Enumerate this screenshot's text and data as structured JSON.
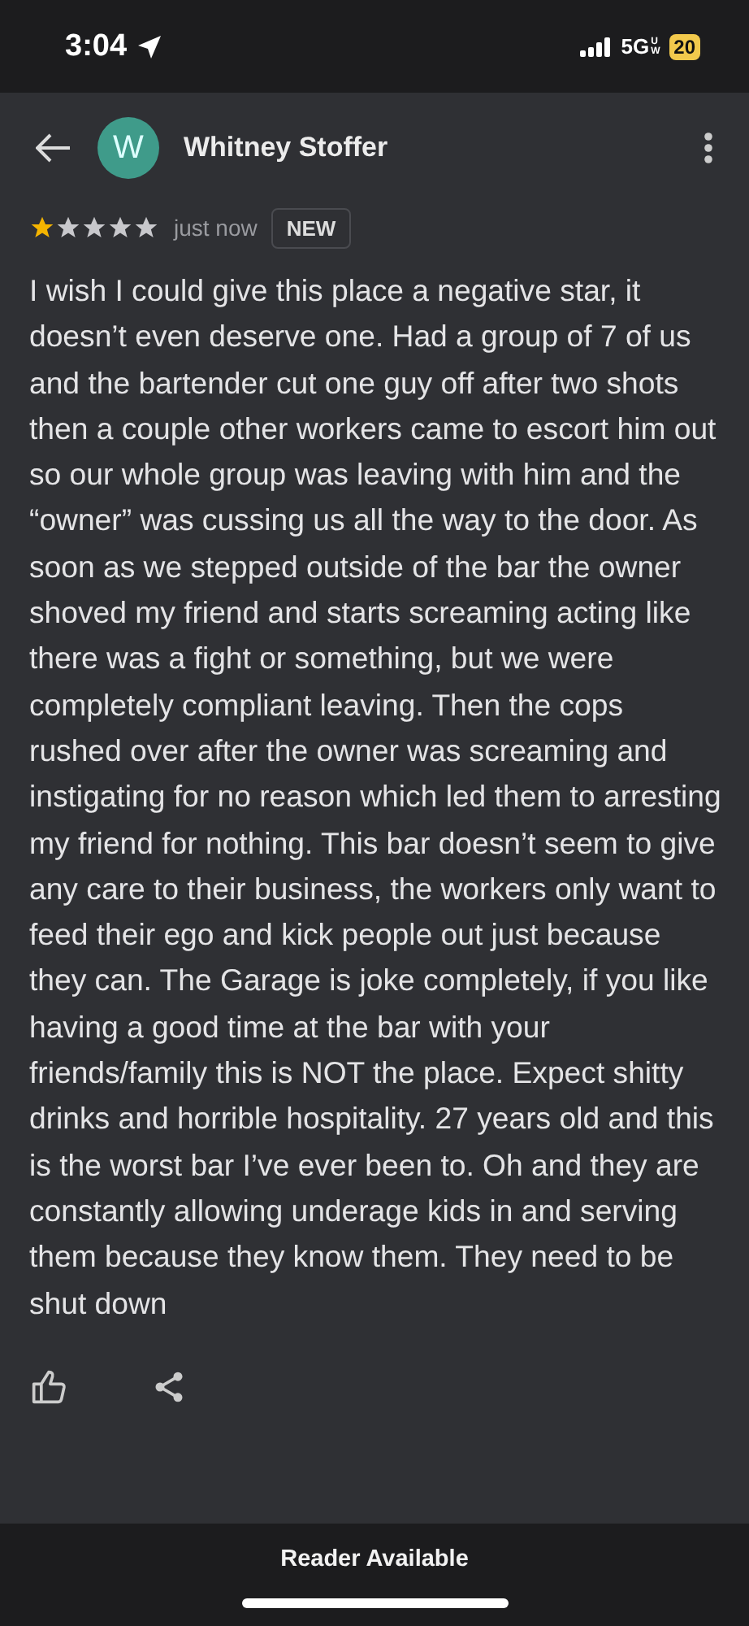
{
  "status_bar": {
    "time": "3:04",
    "network": "5G",
    "network_sub": "UW",
    "battery": "20"
  },
  "header": {
    "avatar_letter": "W",
    "name": "Whitney Stoffer"
  },
  "review": {
    "stars": 1,
    "time": "just now",
    "badge": "NEW",
    "text": "I wish I could give this place a negative star, it doesn’t even deserve one. Had a group of 7 of us and the bartender cut one guy off after two shots then a couple other workers came to escort him out so our whole group was leaving with him and the “owner” was cussing us all the way to the door. As soon as we stepped outside of the bar the owner shoved my friend and starts screaming acting like there was a fight or something, but we were completely compliant leaving. Then the cops rushed over after the owner was screaming and instigating for no reason which led them to arresting my friend for nothing. This bar doesn’t seem to give any care to their business, the workers only want to feed their ego and kick people out just because they can. The Garage is joke completely, if you like having a good time at the bar with your friends/family this is NOT the place. Expect shitty drinks and horrible hospitality. 27 years old and this is the worst bar I’ve ever been to. Oh and they are constantly allowing underage kids in and serving them because they know them. They need to be shut down"
  },
  "browser_bar": {
    "label": "Reader Available"
  }
}
